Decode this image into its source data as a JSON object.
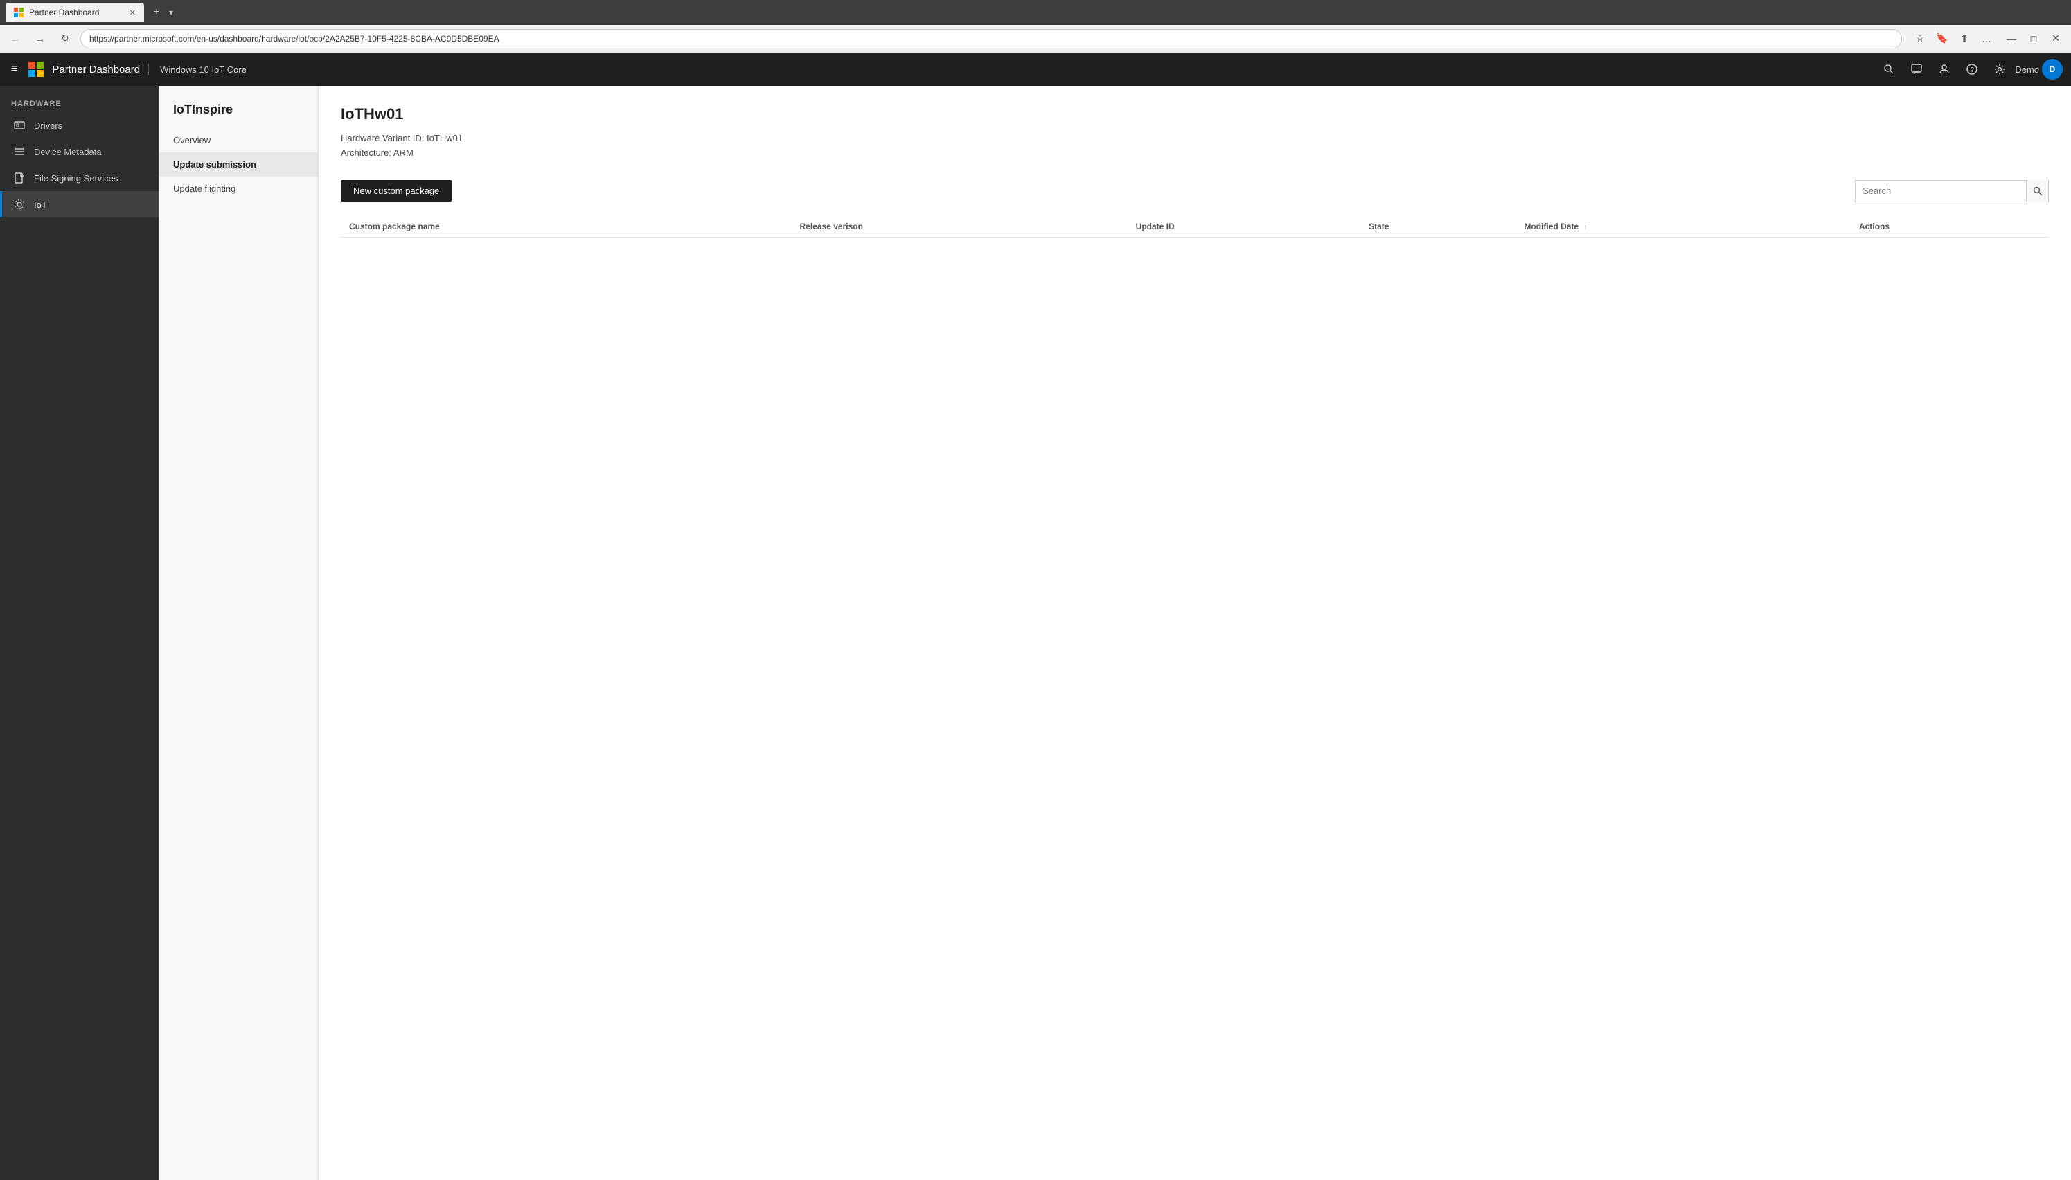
{
  "browser": {
    "tab_label": "Partner Dashboard",
    "tab_favicon": "⊞",
    "url": "https://partner.microsoft.com/en-us/dashboard/hardware/iot/ocp/2A2A25B7-10F5-4225-8CBA-AC9D5DBE09EA",
    "new_tab_icon": "+",
    "dropdown_icon": "▾",
    "nav_back_icon": "←",
    "nav_forward_icon": "→",
    "nav_refresh_icon": "↻",
    "lock_icon": "🔒",
    "star_icon": "☆",
    "bookmark_icon": "🔖",
    "share_icon": "⬆",
    "more_icon": "…",
    "minimize_icon": "—",
    "maximize_icon": "□",
    "close_icon": "✕"
  },
  "topnav": {
    "hamburger_icon": "≡",
    "app_title": "Partner Dashboard",
    "app_subtitle": "Windows 10 IoT Core",
    "search_icon": "🔍",
    "chat_icon": "💬",
    "people_icon": "👤",
    "help_icon": "?",
    "settings_icon": "⚙",
    "user_name": "Demo",
    "user_avatar_initials": "D"
  },
  "sidebar": {
    "section_label": "HARDWARE",
    "items": [
      {
        "id": "drivers",
        "label": "Drivers",
        "icon": "⊟"
      },
      {
        "id": "device-metadata",
        "label": "Device Metadata",
        "icon": "☰"
      },
      {
        "id": "file-signing",
        "label": "File Signing Services",
        "icon": "⊡"
      },
      {
        "id": "iot",
        "label": "IoT",
        "icon": "⚙"
      }
    ]
  },
  "subnav": {
    "title": "IoTInspire",
    "items": [
      {
        "id": "overview",
        "label": "Overview"
      },
      {
        "id": "update-submission",
        "label": "Update submission"
      },
      {
        "id": "update-flighting",
        "label": "Update flighting"
      }
    ]
  },
  "page": {
    "title": "IoTHw01",
    "hardware_variant_id_label": "Hardware Variant ID:",
    "hardware_variant_id_value": "IoTHw01",
    "architecture_label": "Architecture:",
    "architecture_value": "ARM",
    "new_package_btn": "New custom package",
    "search_placeholder": "Search",
    "search_icon": "🔍",
    "table": {
      "columns": [
        {
          "id": "custom-package-name",
          "label": "Custom package name",
          "sortable": false
        },
        {
          "id": "release-version",
          "label": "Release verison",
          "sortable": false
        },
        {
          "id": "update-id",
          "label": "Update ID",
          "sortable": false
        },
        {
          "id": "state",
          "label": "State",
          "sortable": false
        },
        {
          "id": "modified-date",
          "label": "Modified Date",
          "sortable": true,
          "sort_direction": "asc"
        },
        {
          "id": "actions",
          "label": "Actions",
          "sortable": false
        }
      ],
      "rows": []
    }
  }
}
